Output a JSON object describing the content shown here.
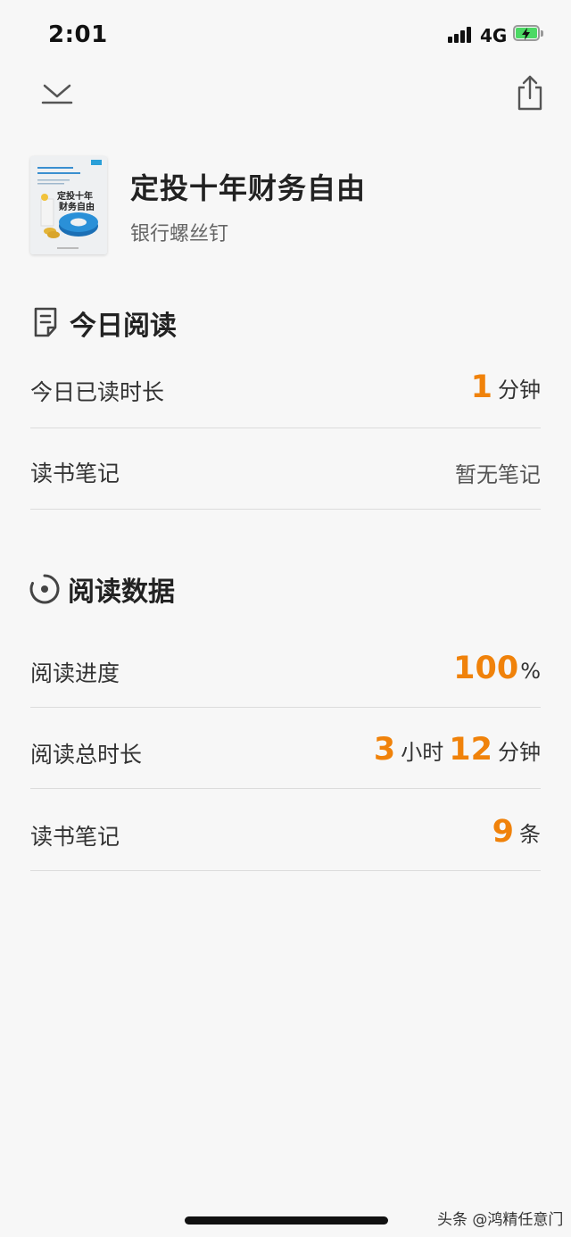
{
  "status_bar": {
    "time": "2:01",
    "network": "4G"
  },
  "book": {
    "title": "定投十年财务自由",
    "author": "银行螺丝钉",
    "cover_title_top": "定投十年",
    "cover_title_bottom": "财务自由"
  },
  "today": {
    "heading": "今日阅读",
    "rows": [
      {
        "label": "今日已读时长",
        "value": "1",
        "unit": "分钟"
      },
      {
        "label": "读书笔记",
        "value_text": "暂无笔记"
      }
    ]
  },
  "stats": {
    "heading": "阅读数据",
    "progress": {
      "label": "阅读进度",
      "value": "100",
      "unit": "%"
    },
    "total_time": {
      "label": "阅读总时长",
      "hours": "3",
      "hours_unit": "小时",
      "minutes": "12",
      "minutes_unit": "分钟"
    },
    "notes": {
      "label": "读书笔记",
      "value": "9",
      "unit": "条"
    }
  },
  "watermark": "头条 @鸿精任意门",
  "colors": {
    "accent": "#f0820a",
    "background": "#f7f7f7",
    "divider": "#dcdcdc"
  }
}
